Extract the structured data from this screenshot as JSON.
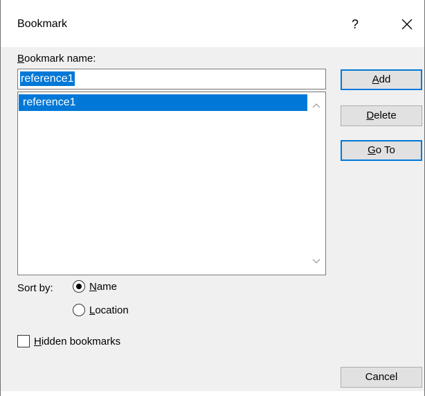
{
  "dialog": {
    "title": "Bookmark",
    "help_label": "?"
  },
  "name_field": {
    "label_mnemonic": "B",
    "label_rest": "ookmark name:",
    "value": "reference1"
  },
  "bookmarks": {
    "items": [
      "reference1"
    ],
    "selected": "reference1"
  },
  "buttons": {
    "add": {
      "mnemonic": "A",
      "rest": "dd"
    },
    "delete": {
      "mnemonic": "D",
      "rest": "elete"
    },
    "goto": {
      "mnemonic": "G",
      "rest": "o To"
    },
    "cancel": "Cancel"
  },
  "sort": {
    "label": "Sort by:",
    "name_mnemonic": "N",
    "name_rest": "ame",
    "location_mnemonic": "L",
    "location_rest": "ocation",
    "selected": "Name"
  },
  "hidden": {
    "mnemonic": "H",
    "rest": "idden bookmarks",
    "checked": false
  },
  "icons": {
    "close": "close-icon",
    "scroll_up": "chevron-up-icon",
    "scroll_down": "chevron-down-icon"
  },
  "colors": {
    "selection": "#0078d7",
    "dialog_bg": "#f0f0f0",
    "button_bg": "#e1e1e1"
  }
}
